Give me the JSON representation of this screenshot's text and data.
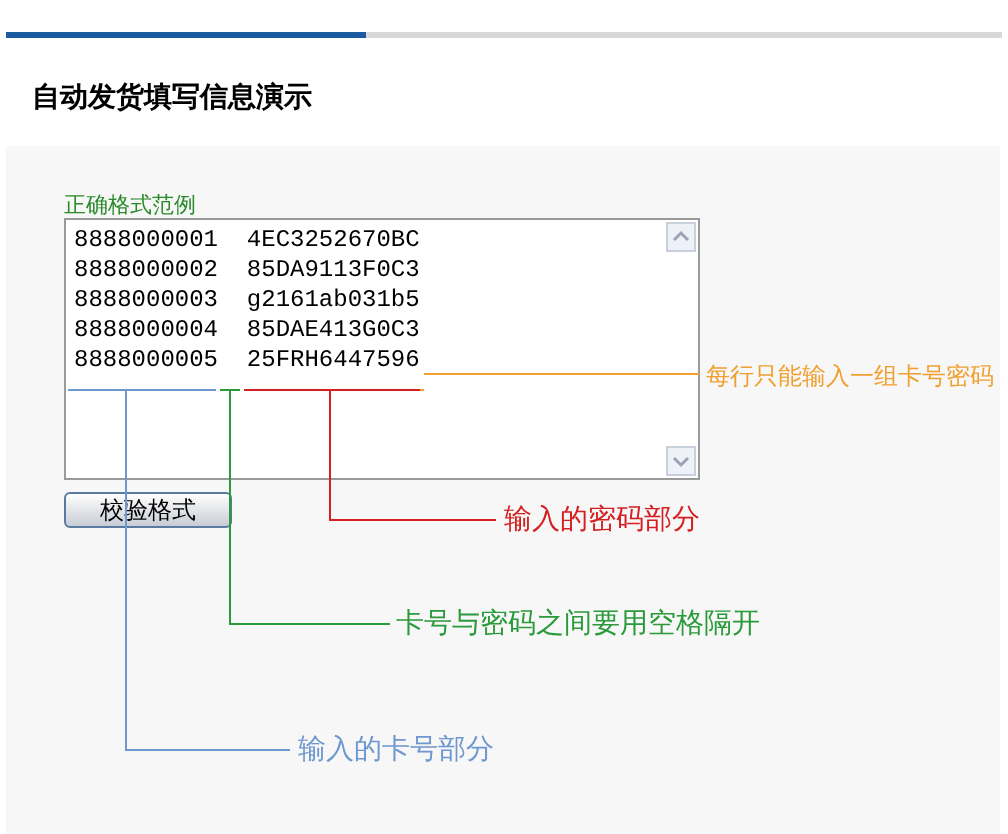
{
  "title": "自动发货填写信息演示",
  "example_label": "正确格式范例",
  "lines": [
    "8888000001  4EC3252670BC",
    "8888000002  85DA9113F0C3",
    "8888000003  g2161ab031b5",
    "8888000004  85DAE413G0C3",
    "8888000005  25FRH6447596"
  ],
  "button": "校验格式",
  "annotations": [
    {
      "kind": "row",
      "text": "每行只能输入一组卡号密码",
      "color": "#f0a030"
    },
    {
      "kind": "password",
      "text": "输入的密码部分",
      "color": "#d42020"
    },
    {
      "kind": "separator",
      "text": "卡号与密码之间要用空格隔开",
      "color": "#2a9a3a"
    },
    {
      "kind": "card",
      "text": "输入的卡号部分",
      "color": "#6f98d0"
    }
  ]
}
